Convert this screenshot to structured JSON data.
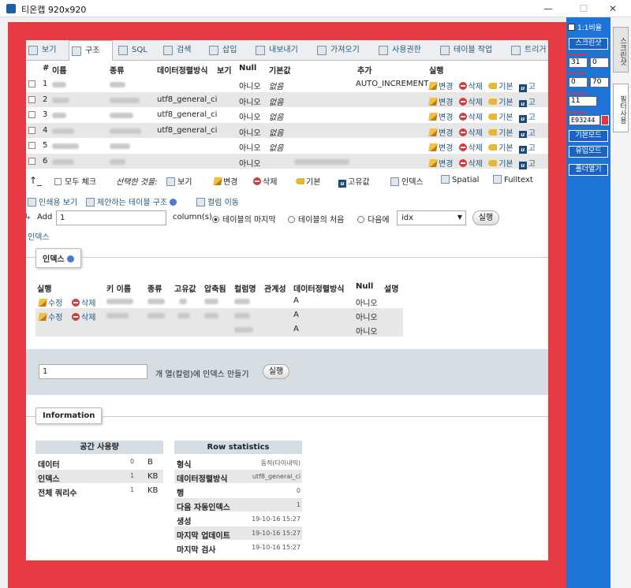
{
  "window": {
    "title": "티온캡 920x920",
    "minimize": "—",
    "maximize": "☐",
    "close": "✕"
  },
  "tabs": [
    {
      "label": "보기"
    },
    {
      "label": "구조"
    },
    {
      "label": "SQL"
    },
    {
      "label": "검색"
    },
    {
      "label": "삽입"
    },
    {
      "label": "내보내기"
    },
    {
      "label": "가져오기"
    },
    {
      "label": "사용권한"
    },
    {
      "label": "테이블 작업"
    },
    {
      "label": "트리거"
    }
  ],
  "columns_header": {
    "num": "#",
    "name": "이름",
    "type": "종류",
    "collation": "데이터정렬방식",
    "attributes": "보기",
    "null": "Null",
    "default": "기본값",
    "extra": "추가",
    "action": "실행"
  },
  "rows": [
    {
      "num": "1",
      "collation": "",
      "null": "아니오",
      "default": "없음",
      "extra": "AUTO_INCREMENT"
    },
    {
      "num": "2",
      "collation": "utf8_general_ci",
      "null": "아니오",
      "default": "없음",
      "extra": ""
    },
    {
      "num": "3",
      "collation": "utf8_general_ci",
      "null": "아니오",
      "default": "없음",
      "extra": ""
    },
    {
      "num": "4",
      "collation": "utf8_general_ci",
      "null": "아니오",
      "default": "없음",
      "extra": ""
    },
    {
      "num": "5",
      "collation": "",
      "null": "아니오",
      "default": "없음",
      "extra": ""
    },
    {
      "num": "6",
      "collation": "",
      "null": "아니오",
      "default": "",
      "extra": ""
    }
  ],
  "row_actions": {
    "change": "변경",
    "drop": "삭제",
    "primary": "기본",
    "unique": "고"
  },
  "selection": {
    "check_all": "모두 체크",
    "with_selected": "선택한 것을:",
    "browse": "보기",
    "change": "변경",
    "drop": "삭제",
    "primary": "기본",
    "unique": "고유값",
    "index": "인덱스",
    "spatial": "Spatial",
    "fulltext": "Fulltext"
  },
  "links": {
    "print_view": "인쇄용 보기",
    "propose_structure": "제안하는 테이블 구조",
    "move_columns": "컬럼 이동",
    "indexes_link": "인덱스"
  },
  "add_columns": {
    "add_label": "Add",
    "count": "1",
    "columns_label": "column(s)",
    "at_end": "테이블의 마지막",
    "at_beginning": "테이블의 처음",
    "after": "다음에",
    "after_column": "idx",
    "go": "실행"
  },
  "indexes": {
    "legend": "인덱스",
    "header": {
      "action": "실행",
      "keyname": "키 이름",
      "type": "종류",
      "unique": "고유값",
      "packed": "압축됨",
      "column": "컬럼명",
      "cardinality": "관계성",
      "collation": "데이터정렬방식",
      "null": "Null",
      "comment": "설명"
    },
    "edit": "수정",
    "drop": "삭제",
    "rows": [
      {
        "collation": "A",
        "null": "아니오"
      },
      {
        "collation": "A",
        "null": "아니오"
      },
      {
        "collation": "A",
        "null": "아니오"
      }
    ],
    "create_count": "1",
    "create_label": "개 열(칼럼)에 인덱스 만들기",
    "create_go": "실행"
  },
  "information": {
    "legend": "Information",
    "space_usage": {
      "title": "공간 사용량",
      "rows": [
        {
          "label": "데이터",
          "value": "0",
          "unit": "B"
        },
        {
          "label": "인덱스",
          "value": "1",
          "unit": "KB"
        },
        {
          "label": "전체 쿼리수",
          "value": "1",
          "unit": "KB"
        }
      ]
    },
    "row_statistics": {
      "title": "Row statistics",
      "rows": [
        {
          "label": "형식",
          "value": "동적(다이내믹)"
        },
        {
          "label": "데이터정렬방식",
          "value": "utf8_general_ci"
        },
        {
          "label": "행",
          "value": "0"
        },
        {
          "label": "다음 자동인덱스",
          "value": "1"
        },
        {
          "label": "생성",
          "value": "19-10-16 15:27"
        },
        {
          "label": "마지막 업데이트",
          "value": "19-10-16 15:27"
        },
        {
          "label": "마지막 검사",
          "value": "19-10-16 15:27"
        }
      ]
    }
  },
  "side_panel": {
    "ratio_check": "1:1비율",
    "screenshot": "스크린샷",
    "spin1": "31",
    "spin2": "0",
    "spin3": "0",
    "spin4": "70",
    "spin5": "11",
    "color_hex": "E93244",
    "basic_mode": "기본모드",
    "user_mode": "유입모드",
    "open_folder": "폴더열기"
  },
  "vertical_tabs": [
    "스크린샷",
    "필터사용"
  ],
  "colors": {
    "frame": "#e63b44",
    "side_panel": "#1e73d6",
    "color_swatch": "#e93244"
  }
}
